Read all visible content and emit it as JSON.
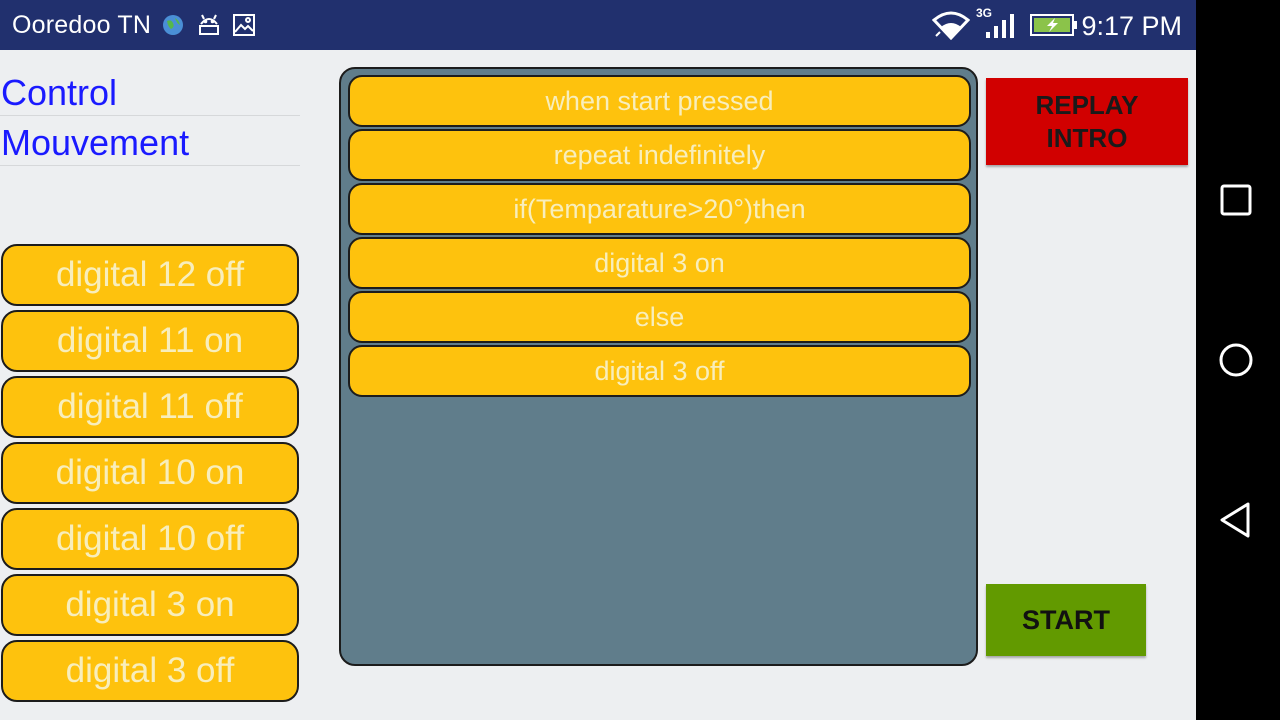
{
  "status_bar": {
    "carrier": "Ooredoo TN",
    "network_type": "3G",
    "time": "9:17 PM",
    "icons": [
      "globe-icon",
      "android-debug-icon",
      "gallery-icon",
      "wifi-icon",
      "signal-icon",
      "battery-charging-icon"
    ]
  },
  "sidebar": {
    "title_line1": "Control",
    "title_line2": "Mouvement",
    "commands": [
      {
        "label": "digital 12 off"
      },
      {
        "label": "digital 11 on"
      },
      {
        "label": "digital 11 off"
      },
      {
        "label": "digital 10 on"
      },
      {
        "label": "digital 10 off"
      },
      {
        "label": "digital 3 on"
      },
      {
        "label": "digital 3 off"
      }
    ]
  },
  "program": {
    "blocks": [
      {
        "label": "when start pressed"
      },
      {
        "label": "repeat indefinitely"
      },
      {
        "label": "if(Temparature>20°)then"
      },
      {
        "label": "digital 3 on"
      },
      {
        "label": "else"
      },
      {
        "label": "digital 3 off"
      }
    ]
  },
  "actions": {
    "replay_line1": "REPLAY",
    "replay_line2": "INTRO",
    "start_label": "START"
  },
  "colors": {
    "status_bar": "#21306e",
    "block": "#fec20d",
    "block_text": "#f8eebc",
    "program_area": "#607d8b",
    "replay": "#d10000",
    "start": "#629a00",
    "title_text": "#1a1aff"
  },
  "nav_bar": {
    "icons": [
      "recents-icon",
      "home-icon",
      "back-icon"
    ]
  }
}
